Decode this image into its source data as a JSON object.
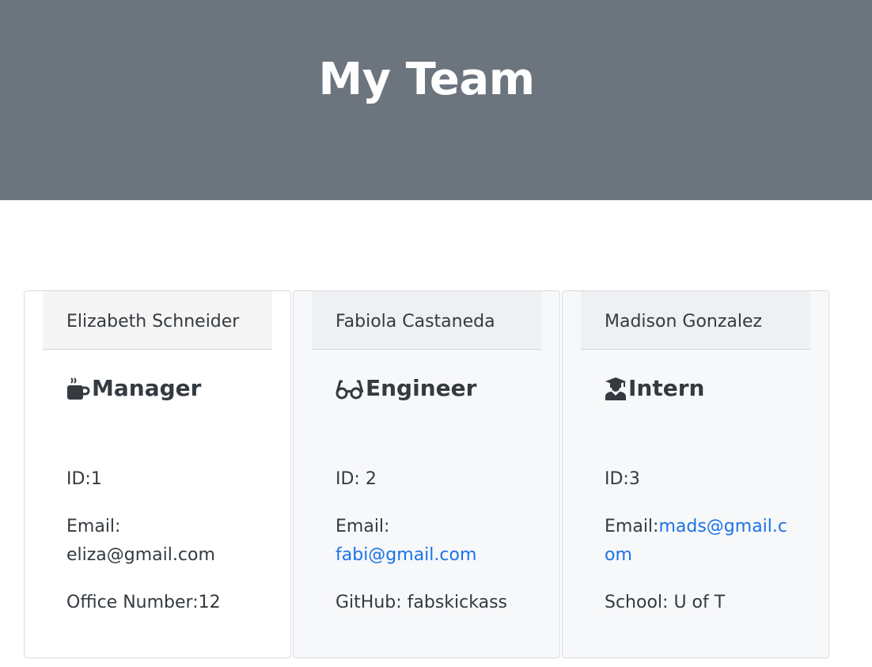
{
  "header": {
    "title": "My Team"
  },
  "cards": [
    {
      "name": "Elizabeth Schneider",
      "role": "Manager",
      "role_icon": "coffee-mug-icon",
      "id_text": "ID:1",
      "email_label": "Email:",
      "email": "eliza@gmail.com",
      "extra_text": "Office Number:12"
    },
    {
      "name": "Fabiola Castaneda",
      "role": "Engineer",
      "role_icon": "glasses-icon",
      "id_text": "ID: 2",
      "email_label": "Email:",
      "email": "fabi@gmail.com",
      "extra_text": "GitHub: fabskickass"
    },
    {
      "name": "Madison Gonzalez",
      "role": "Intern",
      "role_icon": "graduate-icon",
      "id_text": "ID:3",
      "email_label": "Email:",
      "email": "mads@gmail.com",
      "extra_text": "School: U of T"
    }
  ],
  "colors": {
    "header_bg": "#6c757d",
    "link": "#1a73e8"
  }
}
